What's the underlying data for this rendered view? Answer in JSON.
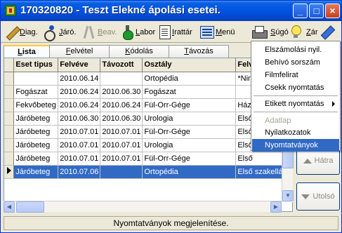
{
  "window": {
    "title": "170320820 - Teszt Elekné ápolási esetei.",
    "minimize": "_",
    "maximize": "□",
    "close": "×"
  },
  "toolbar": {
    "items": [
      {
        "label_pre": "",
        "label_u": "D",
        "label_post": "iag.",
        "icon": "pencil-icon",
        "disabled": false
      },
      {
        "label_pre": "",
        "label_u": "J",
        "label_post": "áró.",
        "icon": "wheelchair-icon",
        "disabled": false
      },
      {
        "label_pre": "",
        "label_u": "B",
        "label_post": "eav.",
        "icon": "crutches-icon",
        "disabled": true
      },
      {
        "label_pre": "",
        "label_u": "L",
        "label_post": "abor",
        "icon": "flask-icon",
        "disabled": false
      },
      {
        "label_pre": "",
        "label_u": "I",
        "label_post": "rattár",
        "icon": "document-icon",
        "disabled": false
      },
      {
        "label_pre": "",
        "label_u": "M",
        "label_post": "enü",
        "icon": "menu-icon",
        "disabled": false
      },
      {
        "label_pre": "",
        "label_u": "",
        "label_post": "",
        "icon": "printer-icon",
        "disabled": false
      },
      {
        "label_pre": "",
        "label_u": "S",
        "label_post": "úgó",
        "icon": "bulb-icon",
        "disabled": false
      },
      {
        "label_pre": "",
        "label_u": "Z",
        "label_post": "ár",
        "icon": "eraser-icon",
        "disabled": false
      }
    ]
  },
  "tabs": [
    {
      "u": "L",
      "rest": "ista",
      "active": true
    },
    {
      "u": "F",
      "rest": "elvétel",
      "active": false
    },
    {
      "u": "K",
      "rest": "ódolás",
      "active": false
    },
    {
      "u": "T",
      "rest": "ávozás",
      "active": false
    }
  ],
  "table": {
    "columns": [
      "Eset tipus",
      "Felvéve",
      "Távozott",
      "Osztály",
      "Felv"
    ],
    "rows": [
      [
        "",
        "2010.06.14",
        "",
        "Ortopédia",
        "*Nin"
      ],
      [
        "Fogászat",
        "2010.06.24",
        "2010.06.30",
        "Fogászat",
        ""
      ],
      [
        "Fekvőbeteg",
        "2010.06.24",
        "2010.06.24",
        "Fül-Orr-Gége",
        "Ház"
      ],
      [
        "Járóbeteg",
        "2010.06.30",
        "2010.06.30",
        "Urologia",
        "Első"
      ],
      [
        "Járóbeteg",
        "2010.07.01",
        "2010.07.01",
        "Fül-Orr-Gége",
        "Első"
      ],
      [
        "Járóbeteg",
        "2010.07.01",
        "2010.07.01",
        "Urologia",
        "Első"
      ],
      [
        "Járóbeteg",
        "2010.07.01",
        "2010.07.01",
        "Fül-Orr-Gége",
        "Első"
      ],
      [
        "Járóbeteg",
        "2010.07.06",
        "",
        "Ortopédia",
        "Első szakellát"
      ]
    ],
    "selected_row": 7
  },
  "nav": {
    "back_label": "Hátra",
    "last_label": "Utolsó"
  },
  "context_menu": {
    "items": [
      {
        "label": "Elszámolási nyil.",
        "disabled": false,
        "submenu": false,
        "highlighted": false
      },
      {
        "label": "Behívó sorszám",
        "disabled": false,
        "submenu": false,
        "highlighted": false
      },
      {
        "label": "Filmfelirat",
        "disabled": false,
        "submenu": false,
        "highlighted": false
      },
      {
        "label": "Csekk nyomtatás",
        "disabled": false,
        "submenu": false,
        "highlighted": false
      },
      {
        "label": "Etikett nyomtatás",
        "disabled": false,
        "submenu": true,
        "highlighted": false
      },
      {
        "label": "Adatlap",
        "disabled": true,
        "submenu": false,
        "highlighted": false
      },
      {
        "label": "Nyilatkozatok",
        "disabled": false,
        "submenu": false,
        "highlighted": false
      },
      {
        "label": "Nyomtatványok",
        "disabled": false,
        "submenu": false,
        "highlighted": true
      }
    ]
  },
  "status": {
    "text": "Nyomtatványok megjelenítése."
  },
  "colors": {
    "titlebar": "#0054e3",
    "selection": "#316ac5",
    "window_bg": "#ece9d8"
  }
}
